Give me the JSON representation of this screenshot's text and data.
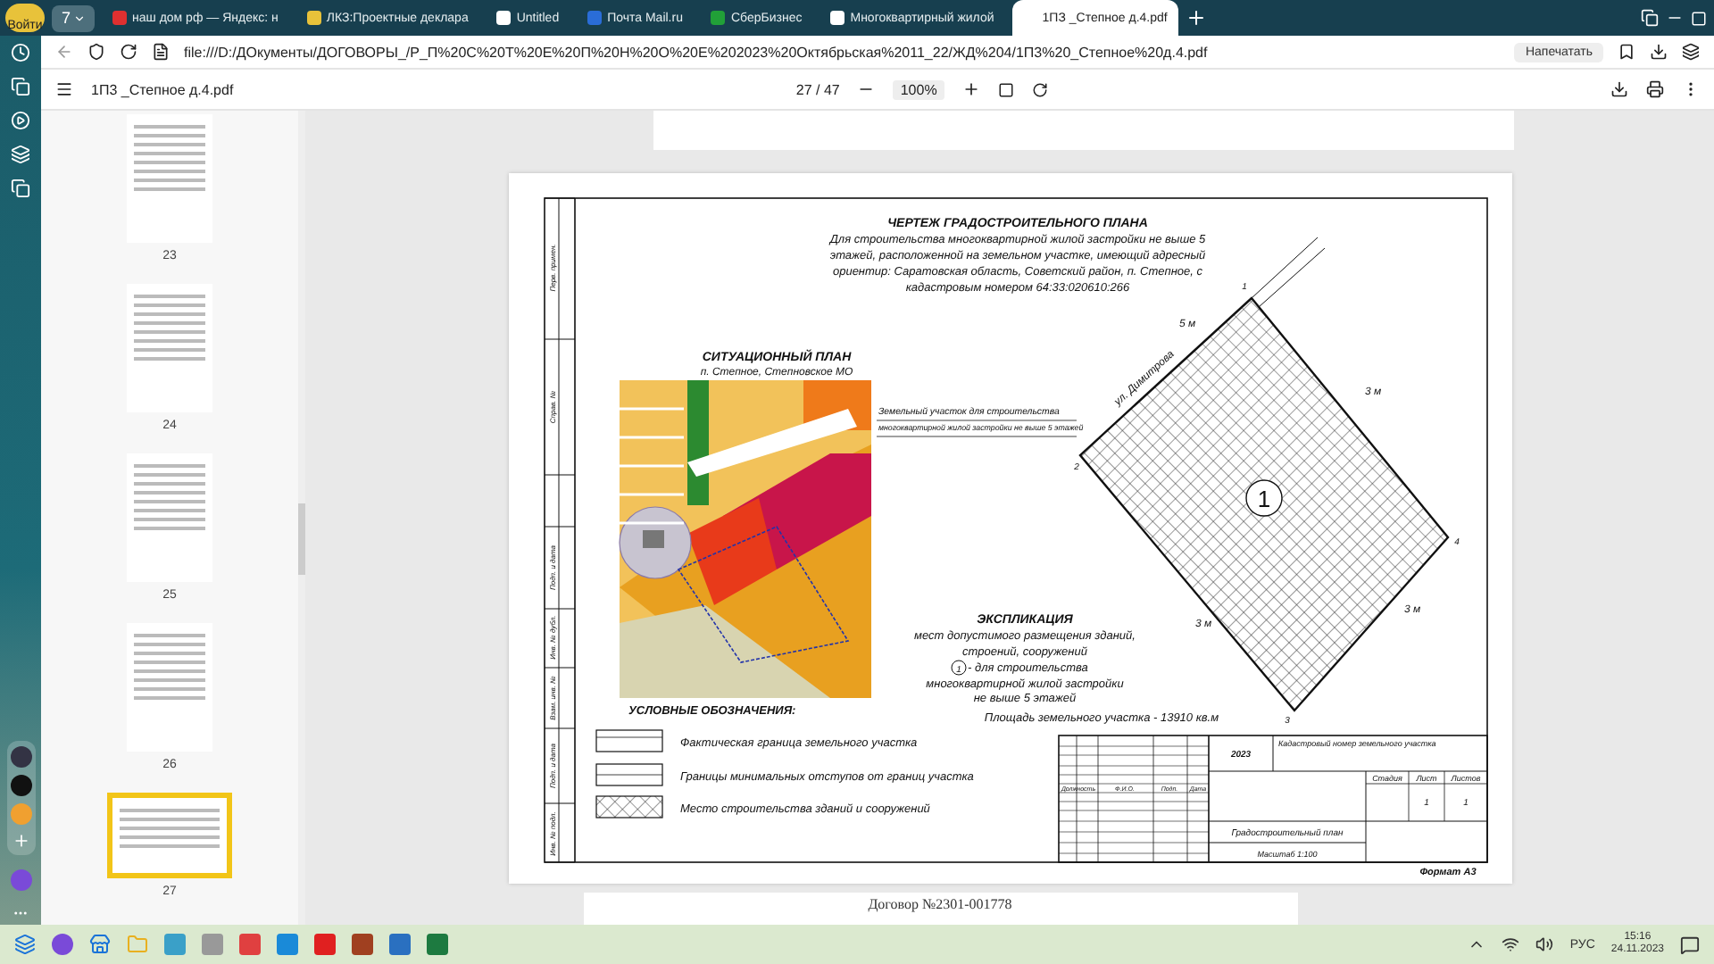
{
  "browser": {
    "profile_label": "Войти",
    "tab_group_count": "7",
    "tabs": [
      {
        "title": "наш дом рф — Яндекс: н",
        "selected": false
      },
      {
        "title": "ЛКЗ:Проектные деклара",
        "selected": false
      },
      {
        "title": "Untitled",
        "selected": false
      },
      {
        "title": "Почта Mail.ru",
        "selected": false
      },
      {
        "title": "СберБизнес",
        "selected": false
      },
      {
        "title": "Многоквартирный жилой",
        "selected": false
      },
      {
        "title": "1ПЗ _Степное д.4.pdf",
        "selected": true
      }
    ],
    "url": "file:///D:/ДОкументы/ДОГОВОРЫ_/Р_П%20С%20Т%20Е%20П%20Н%20О%20Е%202023%20Октябрьская%2011_22/ЖД%204/1П3%20_Степное%20д.4.pdf",
    "print_button": "Напечатать"
  },
  "pdf_toolbar": {
    "title": "1П3 _Степное д.4.pdf",
    "page": "27 / 47",
    "zoom": "100%"
  },
  "thumbnails": [
    {
      "label": "23",
      "selected": false
    },
    {
      "label": "24",
      "selected": false
    },
    {
      "label": "25",
      "selected": false
    },
    {
      "label": "26",
      "selected": false
    },
    {
      "label": "27",
      "selected": true
    }
  ],
  "drawing": {
    "title": "ЧЕРТЕЖ ГРАДОСТРОИТЕЛЬНОГО ПЛАНА",
    "subtitle_lines": [
      "Для строительства многоквартирной жилой застройки не выше 5",
      "этажей, расположенной на земельном участке, имеющий адресный",
      "ориентир: Саратовская область, Советский район, п. Степное, с",
      "кадастровым номером 64:33:020610:266"
    ],
    "stamp_labels": [
      "Перв. примен.",
      "Справ. №",
      "Подп. и дата",
      "Инв. № дубл.",
      "Взам. инв. №",
      "Подп. и дата",
      "Инв. № подл."
    ],
    "site_plan": {
      "title": "СИТУАЦИОННЫЙ ПЛАН",
      "subtitle": "п. Степное, Степновское МО",
      "callout_lines": [
        "Земельный участок для строительства",
        "многоквартирной жилой застройки не выше 5 этажей"
      ]
    },
    "plot": {
      "street": "ул. Димитрова",
      "zone_number": "1",
      "points": [
        "1",
        "2",
        "3",
        "4"
      ],
      "setbacks": [
        "5 м",
        "3 м",
        "3 м",
        "3 м"
      ]
    },
    "explication": {
      "title": "ЭКСПЛИКАЦИЯ",
      "lines": [
        "мест допустимого размещения зданий,",
        "строений, сооружений"
      ],
      "item_number": "1",
      "item_lines": [
        "- для строительства",
        "многоквартирной жилой застройки",
        "не выше 5 этажей"
      ]
    },
    "area": "Площадь земельного участка - 13910 кв.м",
    "legend": {
      "title": "УСЛОВНЫЕ ОБОЗНАЧЕНИЯ:",
      "items": [
        {
          "kind": "boundary",
          "label": "Фактическая граница земельного участка"
        },
        {
          "kind": "setback",
          "label": "Границы минимальных отступов от границ участка"
        },
        {
          "kind": "hatched",
          "label": "Место строительства зданий и сооружений"
        }
      ]
    },
    "title_block": {
      "year": "2023",
      "cadastral_label": "Кадастровый номер земельного участка",
      "headers": [
        "Должность",
        "Ф.И.О.",
        "Подп.",
        "Дата"
      ],
      "stage_headers": [
        "Стадия",
        "Лист",
        "Листов"
      ],
      "sheet": "1",
      "sheets": "1",
      "drawing_name": "Градостроительный план",
      "scale": "Масштаб 1:100"
    },
    "format": "Формат А3"
  },
  "next_page_text": "Договор №2301-001778",
  "taskbar": {
    "language": "РУС",
    "time": "15:16",
    "date": "24.11.2023"
  }
}
